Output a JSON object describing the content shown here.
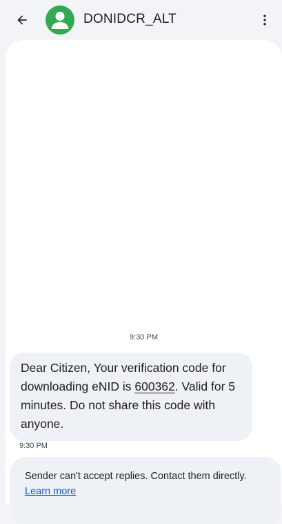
{
  "header": {
    "title": "DONIDCR_ALT",
    "back_icon": "arrow-back-icon",
    "avatar_icon": "person-avatar-icon",
    "menu_icon": "more-vert-icon",
    "avatar_color": "#34a853"
  },
  "conversation": {
    "timestamp_top": "9:30 PM",
    "message": {
      "text_before": "Dear Citizen, Your verification code for downloading eNID is ",
      "code": "600362",
      "text_after": ". Valid for 5 minutes. Do not share this code with anyone.",
      "time": "9:30 PM"
    },
    "notice": {
      "text": "Sender can't accept replies. Contact them directly. ",
      "link": "Learn more",
      "link_color": "#0b57d0"
    }
  }
}
